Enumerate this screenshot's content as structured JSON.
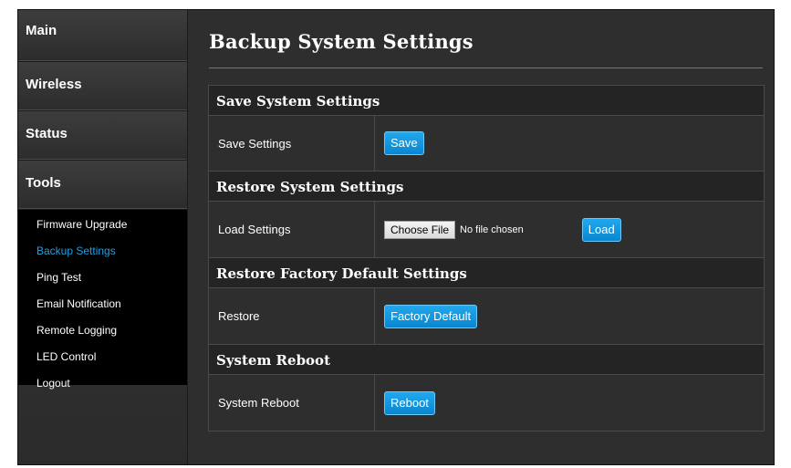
{
  "sidebar": {
    "sections": [
      "Main",
      "Wireless",
      "Status",
      "Tools"
    ],
    "tools_items": [
      {
        "label": "Firmware Upgrade",
        "active": false
      },
      {
        "label": "Backup Settings",
        "active": true
      },
      {
        "label": "Ping Test",
        "active": false
      },
      {
        "label": "Email Notification",
        "active": false
      },
      {
        "label": "Remote Logging",
        "active": false
      },
      {
        "label": "LED Control",
        "active": false
      },
      {
        "label": "Logout",
        "active": false
      }
    ],
    "active_color": "#1da0e4"
  },
  "main": {
    "title": "Backup System Settings",
    "sections": [
      {
        "header": "Save System Settings",
        "label": "Save Settings",
        "button": "Save"
      },
      {
        "header": "Restore System Settings",
        "label": "Load Settings",
        "file_button": "Choose File",
        "file_status": "No file chosen",
        "button": "Load"
      },
      {
        "header": "Restore Factory Default Settings",
        "label": "Restore",
        "button": "Factory Default"
      },
      {
        "header": "System Reboot",
        "label": "System Reboot",
        "button": "Reboot"
      }
    ]
  },
  "colors": {
    "button": "#1596dd",
    "background": "#2e2e2e",
    "header": "#242424"
  }
}
